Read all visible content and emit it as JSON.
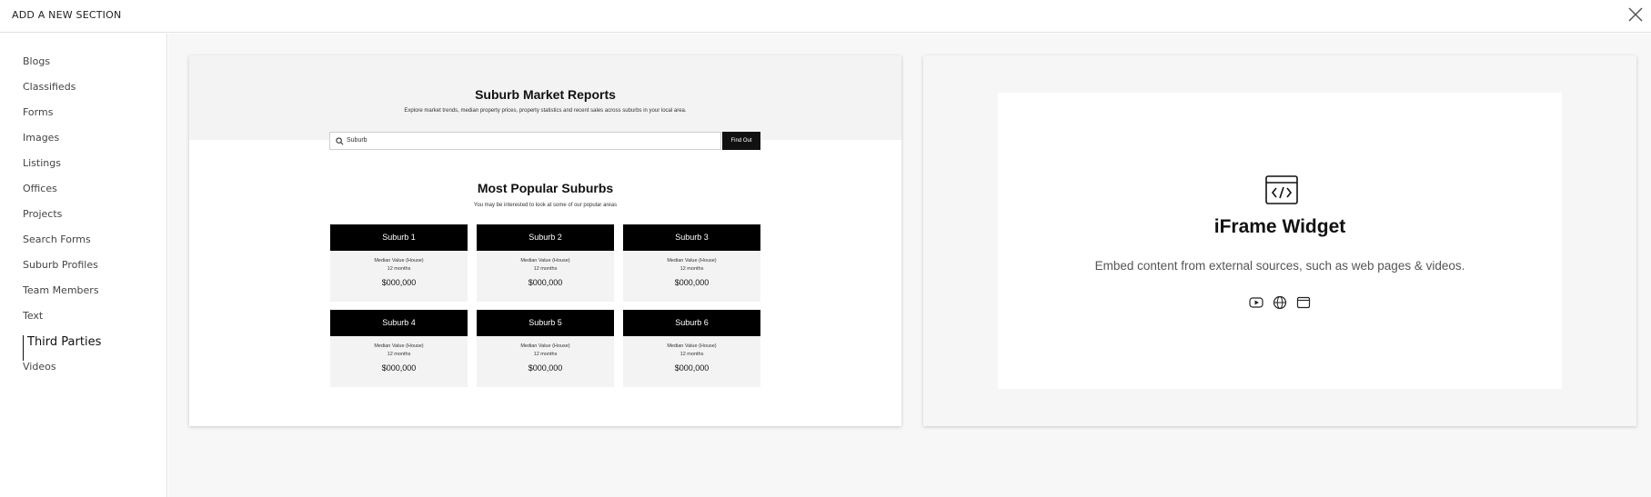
{
  "header": {
    "title": "ADD A NEW SECTION"
  },
  "sidebar": {
    "items": [
      {
        "label": "Blogs"
      },
      {
        "label": "Classifieds"
      },
      {
        "label": "Forms"
      },
      {
        "label": "Images"
      },
      {
        "label": "Listings"
      },
      {
        "label": "Offices"
      },
      {
        "label": "Projects"
      },
      {
        "label": "Search Forms"
      },
      {
        "label": "Suburb Profiles"
      },
      {
        "label": "Team Members"
      },
      {
        "label": "Text"
      },
      {
        "label": "Third Parties"
      },
      {
        "label": "Videos"
      }
    ],
    "active_item": "Third Parties"
  },
  "market_card": {
    "title": "Suburb Market Reports",
    "subtitle": "Explore market trends, median property prices, property statistics and recent sales across suburbs in your local area.",
    "search_value": "Suburb",
    "search_button": "Find Out",
    "popular_title": "Most Popular Suburbs",
    "popular_subtitle": "You may be interested to look at some of our popular areas",
    "suburbs": [
      {
        "name": "Suburb 1",
        "line1": "Median Value (House)",
        "line2": "12 months",
        "value": "$000,000"
      },
      {
        "name": "Suburb 2",
        "line1": "Median Value (House)",
        "line2": "12 months",
        "value": "$000,000"
      },
      {
        "name": "Suburb 3",
        "line1": "Median Value (House)",
        "line2": "12 months",
        "value": "$000,000"
      },
      {
        "name": "Suburb 4",
        "line1": "Median Value (House)",
        "line2": "12 months",
        "value": "$000,000"
      },
      {
        "name": "Suburb 5",
        "line1": "Median Value (House)",
        "line2": "12 months",
        "value": "$000,000"
      },
      {
        "name": "Suburb 6",
        "line1": "Median Value (House)",
        "line2": "12 months",
        "value": "$000,000"
      }
    ]
  },
  "iframe_card": {
    "title": "iFrame Widget",
    "description": "Embed content from external sources, such as web pages & videos.",
    "icons": [
      "code-window-icon",
      "video-play-icon",
      "globe-icon",
      "browser-window-icon"
    ]
  }
}
